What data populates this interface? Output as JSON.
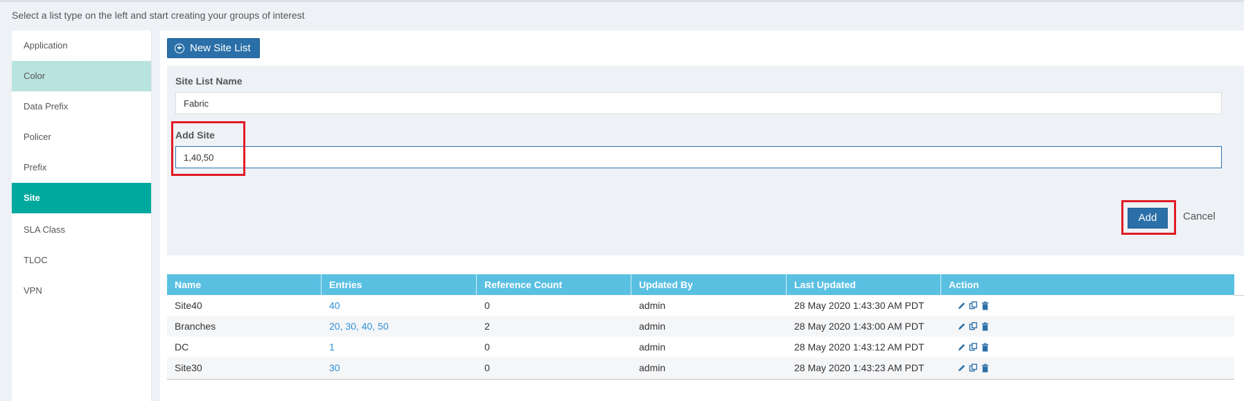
{
  "instruction": "Select a list type on the left and start creating your groups of interest",
  "sidebar": {
    "items": [
      {
        "label": "Application"
      },
      {
        "label": "Color"
      },
      {
        "label": "Data Prefix"
      },
      {
        "label": "Policer"
      },
      {
        "label": "Prefix"
      },
      {
        "label": "Site"
      },
      {
        "label": "SLA Class"
      },
      {
        "label": "TLOC"
      },
      {
        "label": "VPN"
      }
    ]
  },
  "toolbar": {
    "new_button_label": "New Site List",
    "new_button_icon": "plus-circle-icon"
  },
  "form": {
    "name_label": "Site List Name",
    "name_value": "Fabric",
    "add_site_label": "Add Site",
    "add_site_value": "1,40,50",
    "add_button": "Add",
    "cancel_button": "Cancel"
  },
  "colors": {
    "accent": "#2a6fa8",
    "selected": "#00a99d",
    "table_header": "#5ac0e2",
    "highlight": "#e01b24"
  },
  "table": {
    "headers": [
      "Name",
      "Entries",
      "Reference Count",
      "Updated By",
      "Last Updated",
      "Action"
    ],
    "rows": [
      {
        "name": "Site40",
        "entries": "40",
        "ref": "0",
        "by": "admin",
        "updated": "28 May 2020 1:43:30 AM PDT"
      },
      {
        "name": "Branches",
        "entries": "20, 30, 40, 50",
        "ref": "2",
        "by": "admin",
        "updated": "28 May 2020 1:43:00 AM PDT"
      },
      {
        "name": "DC",
        "entries": "1",
        "ref": "0",
        "by": "admin",
        "updated": "28 May 2020 1:43:12 AM PDT"
      },
      {
        "name": "Site30",
        "entries": "30",
        "ref": "0",
        "by": "admin",
        "updated": "28 May 2020 1:43:23 AM PDT"
      }
    ],
    "action_icons": [
      "edit-icon",
      "copy-icon",
      "delete-icon"
    ]
  }
}
